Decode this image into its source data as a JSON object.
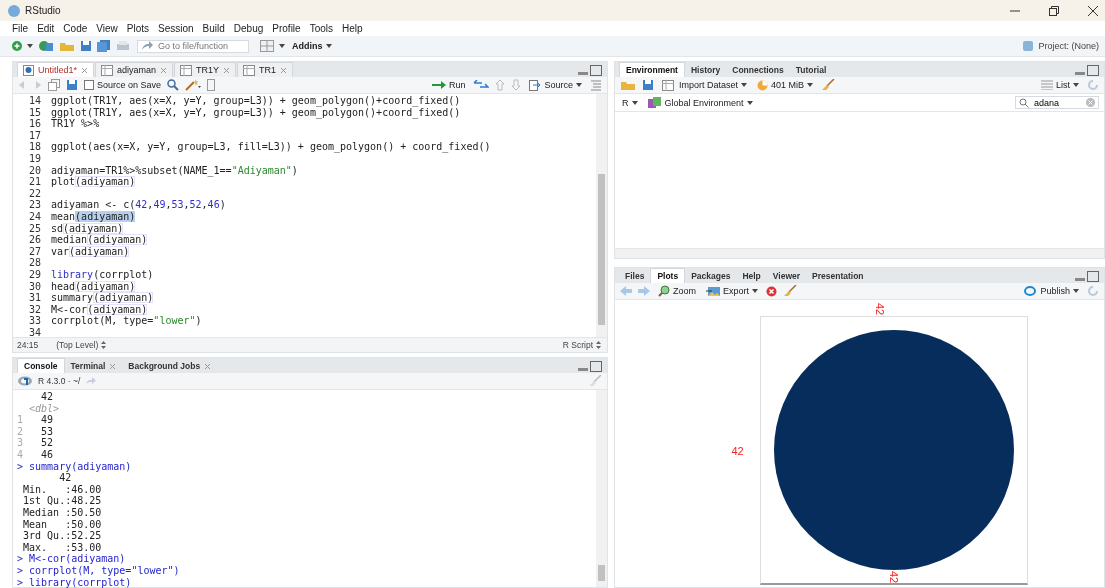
{
  "window": {
    "title": "RStudio"
  },
  "menu": [
    "File",
    "Edit",
    "Code",
    "View",
    "Plots",
    "Session",
    "Build",
    "Debug",
    "Profile",
    "Tools",
    "Help"
  ],
  "toolbar": {
    "goto_placeholder": "Go to file/function",
    "addins": "Addins",
    "project": "Project: (None)"
  },
  "editor": {
    "tabs": [
      {
        "label": "Untitled1*",
        "kind": "script",
        "selected": true
      },
      {
        "label": "adiyaman",
        "kind": "data",
        "selected": false
      },
      {
        "label": "TR1Y",
        "kind": "data",
        "selected": false
      },
      {
        "label": "TR1",
        "kind": "data",
        "selected": false
      }
    ],
    "source_on_save": {
      "label": "Source on Save",
      "checked": false
    },
    "run": "Run",
    "source": "Source",
    "lines": [
      {
        "number": "14",
        "tokens": [
          {
            "kind": "code",
            "text": "ggplot(TR1Y, aes(x=X, y=Y, group=L3)) + geom_polygon()+coord_fixed()"
          }
        ]
      },
      {
        "number": "15",
        "tokens": [
          {
            "kind": "code",
            "text": "ggplot(TR1Y, aes(x=X, y=Y, group=L3)) + geom_polygon()+coord_fixed()"
          }
        ]
      },
      {
        "number": "16",
        "tokens": [
          {
            "kind": "code",
            "text": "TR1Y %>%"
          }
        ]
      },
      {
        "number": "17"
      },
      {
        "number": "18",
        "tokens": [
          {
            "kind": "code",
            "text": "ggplot(aes(x=X, y=Y, group=L3, fill=L3)) + geom_polygon() + coord_fixed()"
          }
        ]
      },
      {
        "number": "19"
      },
      {
        "number": "20",
        "tokens": [
          {
            "kind": "code",
            "text": "adiyaman=TR1%>%subset(NAME_1=="
          },
          {
            "kind": "string",
            "text": "\"Adiyaman\""
          },
          {
            "kind": "code",
            "text": ")"
          }
        ]
      },
      {
        "number": "21",
        "tokens": [
          {
            "kind": "code",
            "text": "plot"
          },
          {
            "kind": "match",
            "text": "(adiyaman)"
          }
        ]
      },
      {
        "number": "22"
      },
      {
        "number": "23",
        "tokens": [
          {
            "kind": "code",
            "text": "adiyaman <- c("
          },
          {
            "kind": "number",
            "text": "42"
          },
          {
            "kind": "code",
            "text": ","
          },
          {
            "kind": "number",
            "text": "49"
          },
          {
            "kind": "code",
            "text": ","
          },
          {
            "kind": "number",
            "text": "53"
          },
          {
            "kind": "code",
            "text": ","
          },
          {
            "kind": "number",
            "text": "52"
          },
          {
            "kind": "code",
            "text": ","
          },
          {
            "kind": "number",
            "text": "46"
          },
          {
            "kind": "code",
            "text": ")"
          }
        ]
      },
      {
        "number": "24",
        "tokens": [
          {
            "kind": "code",
            "text": "mean"
          },
          {
            "kind": "selected",
            "text": "(adiyaman)"
          }
        ]
      },
      {
        "number": "25",
        "tokens": [
          {
            "kind": "code",
            "text": "sd"
          },
          {
            "kind": "match",
            "text": "(adiyaman)"
          }
        ]
      },
      {
        "number": "26",
        "tokens": [
          {
            "kind": "code",
            "text": "median"
          },
          {
            "kind": "match",
            "text": "(adiyaman)"
          }
        ]
      },
      {
        "number": "27",
        "tokens": [
          {
            "kind": "code",
            "text": "var"
          },
          {
            "kind": "match",
            "text": "(adiyaman)"
          }
        ]
      },
      {
        "number": "28"
      },
      {
        "number": "29",
        "tokens": [
          {
            "kind": "keyword",
            "text": "library"
          },
          {
            "kind": "code",
            "text": "(corrplot)"
          }
        ]
      },
      {
        "number": "30",
        "tokens": [
          {
            "kind": "code",
            "text": "head"
          },
          {
            "kind": "match",
            "text": "(adiyaman)"
          }
        ]
      },
      {
        "number": "31",
        "tokens": [
          {
            "kind": "code",
            "text": "summary"
          },
          {
            "kind": "match",
            "text": "(adiyaman)"
          }
        ]
      },
      {
        "number": "32",
        "tokens": [
          {
            "kind": "code",
            "text": "M<-cor"
          },
          {
            "kind": "match",
            "text": "(adiyaman)"
          }
        ]
      },
      {
        "number": "33",
        "tokens": [
          {
            "kind": "code",
            "text": "corrplot(M, type="
          },
          {
            "kind": "string",
            "text": "\"lower\""
          },
          {
            "kind": "code",
            "text": ")"
          }
        ]
      },
      {
        "number": "34"
      }
    ],
    "cursor": "24:15",
    "scope": "(Top Level)",
    "filetype": "R Script"
  },
  "console": {
    "tabs": [
      {
        "label": "Console",
        "closable": false,
        "selected": true
      },
      {
        "label": "Terminal",
        "closable": true,
        "selected": false
      },
      {
        "label": "Background Jobs",
        "closable": true,
        "selected": false
      }
    ],
    "version": "R 4.3.0 · ~/",
    "lines": [
      {
        "kind": "output",
        "text": "    42"
      },
      {
        "kind": "type",
        "text": "  <dbl>"
      },
      {
        "kind": "row",
        "index": "1",
        "text": "49"
      },
      {
        "kind": "row",
        "index": "2",
        "text": "53"
      },
      {
        "kind": "row",
        "index": "3",
        "text": "52"
      },
      {
        "kind": "row",
        "index": "4",
        "text": "46"
      },
      {
        "kind": "input",
        "text": "> summary(adiyaman)"
      },
      {
        "kind": "output",
        "text": "       42"
      },
      {
        "kind": "output",
        "text": " Min.   :46.00"
      },
      {
        "kind": "output",
        "text": " 1st Qu.:48.25"
      },
      {
        "kind": "output",
        "text": " Median :50.50"
      },
      {
        "kind": "output",
        "text": " Mean   :50.00"
      },
      {
        "kind": "output",
        "text": " 3rd Qu.:52.25"
      },
      {
        "kind": "output",
        "text": " Max.   :53.00"
      },
      {
        "kind": "input",
        "text": "> M<-cor(adiyaman)"
      },
      {
        "kind": "input",
        "text": "> corrplot(M, type=\"lower\")"
      },
      {
        "kind": "input",
        "text": "> library(corrplot)"
      }
    ]
  },
  "environment": {
    "tabs": [
      {
        "label": "Environment",
        "selected": true
      },
      {
        "label": "History",
        "selected": false
      },
      {
        "label": "Connections",
        "selected": false
      },
      {
        "label": "Tutorial",
        "selected": false
      }
    ],
    "import": "Import Dataset",
    "memory": "401 MiB",
    "view": "List",
    "language": "R",
    "scope": "Global Environment",
    "search": "adana"
  },
  "files": {
    "tabs": [
      {
        "label": "Files",
        "selected": false
      },
      {
        "label": "Plots",
        "selected": true
      },
      {
        "label": "Packages",
        "selected": false
      },
      {
        "label": "Help",
        "selected": false
      },
      {
        "label": "Viewer",
        "selected": false
      },
      {
        "label": "Presentation",
        "selected": false
      }
    ],
    "zoom": "Zoom",
    "export": "Export",
    "publish": "Publish",
    "plot": {
      "top_label": "42",
      "left_label": "42",
      "bottom_label": "42"
    }
  }
}
